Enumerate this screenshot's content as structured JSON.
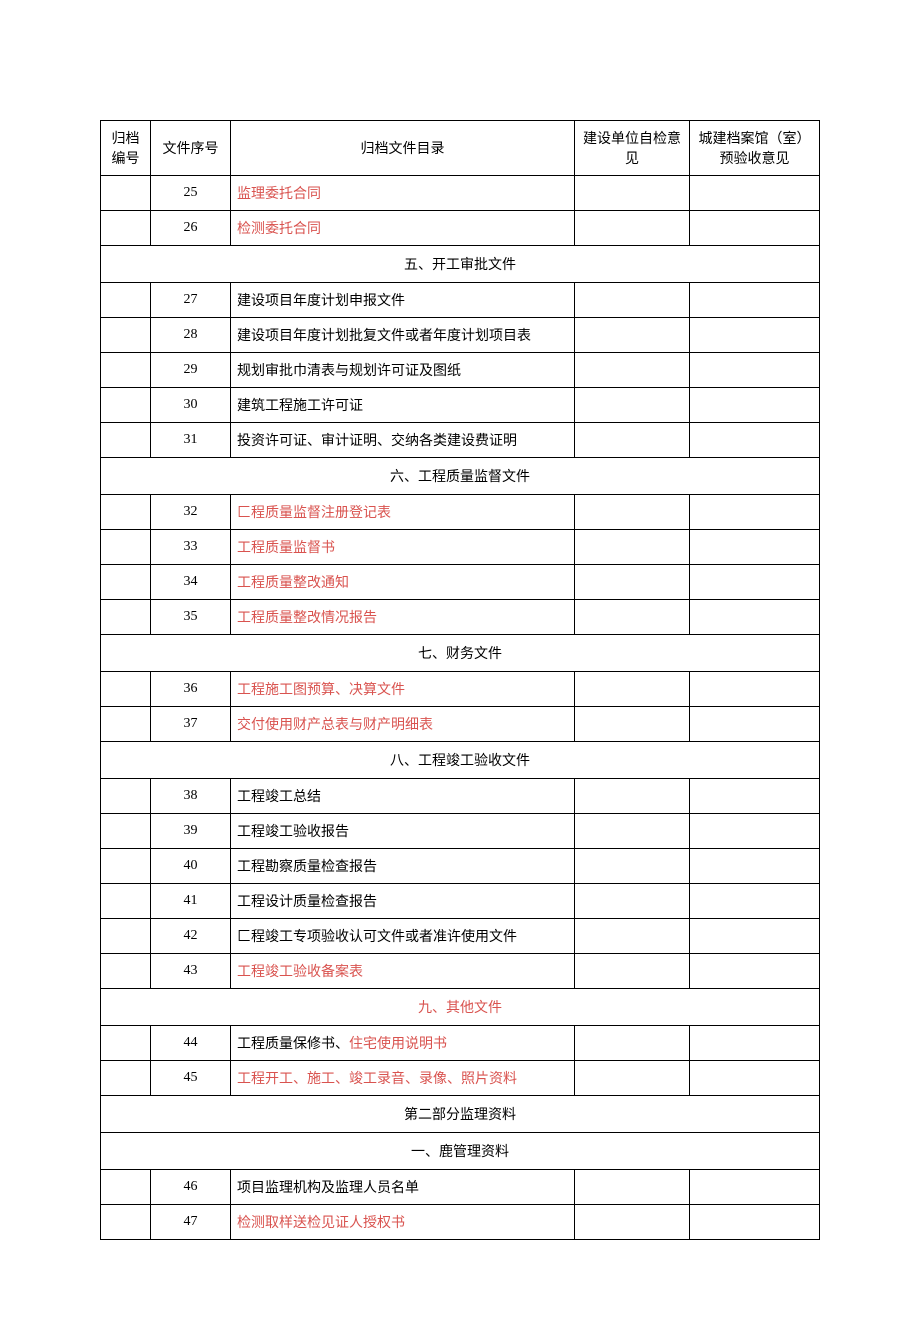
{
  "header": {
    "col_id": "归档编号",
    "col_seq": "文件序号",
    "col_name": "归档文件目录",
    "col_inspect": "建设单位自检意见",
    "col_accept": "城建档案馆（室）预验收意见"
  },
  "rows": [
    {
      "type": "item",
      "seq": "25",
      "name": "监理委托合同",
      "red": true
    },
    {
      "type": "item",
      "seq": "26",
      "name": "检测委托合同",
      "red": true
    },
    {
      "type": "section",
      "title": "五、开工审批文件",
      "red": false
    },
    {
      "type": "item",
      "seq": "27",
      "name": "建设项目年度计划申报文件",
      "red": false
    },
    {
      "type": "item",
      "seq": "28",
      "name": "建设项目年度计划批复文件或者年度计划项目表",
      "red": false
    },
    {
      "type": "item",
      "seq": "29",
      "name": "规划审批巾清表与规划许可证及图纸",
      "red": false
    },
    {
      "type": "item",
      "seq": "30",
      "name": "建筑工程施工许可证",
      "red": false
    },
    {
      "type": "item",
      "seq": "31",
      "name": "投资许可证、审计证明、交纳各类建设费证明",
      "red": false
    },
    {
      "type": "section",
      "title": "六、工程质量监督文件",
      "red": false
    },
    {
      "type": "item",
      "seq": "32",
      "name": "匚程质量监督注册登记表",
      "red": true
    },
    {
      "type": "item",
      "seq": "33",
      "name": "工程质量监督书",
      "red": true
    },
    {
      "type": "item",
      "seq": "34",
      "name": "工程质量整改通知",
      "red": true
    },
    {
      "type": "item",
      "seq": "35",
      "name": "工程质量整改情况报告",
      "red": true
    },
    {
      "type": "section",
      "title": "七、财务文件",
      "red": false
    },
    {
      "type": "item",
      "seq": "36",
      "name": "工程施工图预算、决算文件",
      "red": true
    },
    {
      "type": "item",
      "seq": "37",
      "name": "交付使用财产总表与财产明细表",
      "red": true
    },
    {
      "type": "section",
      "title": "八、工程竣工验收文件",
      "red": false
    },
    {
      "type": "item",
      "seq": "38",
      "name": "工程竣工总结",
      "red": false
    },
    {
      "type": "item",
      "seq": "39",
      "name": "工程竣工验收报告",
      "red": false
    },
    {
      "type": "item",
      "seq": "40",
      "name": "工程勘察质量检查报告",
      "red": false
    },
    {
      "type": "item",
      "seq": "41",
      "name": "工程设计质量检查报告",
      "red": false
    },
    {
      "type": "item",
      "seq": "42",
      "name": "匚程竣工专项验收认可文件或者准许使用文件",
      "red": false
    },
    {
      "type": "item",
      "seq": "43",
      "name": "工程竣工验收备案表",
      "red": true
    },
    {
      "type": "section",
      "title": "九、其他文件",
      "red": true
    },
    {
      "type": "mixed",
      "seq": "44",
      "parts": [
        {
          "text": "工程质量保修书、",
          "red": false
        },
        {
          "text": "住宅使用说明书",
          "red": true
        }
      ]
    },
    {
      "type": "item",
      "seq": "45",
      "name": "工程开工、施工、竣工录音、录像、照片资料",
      "red": true
    },
    {
      "type": "section",
      "title": "第二部分监理资料",
      "red": false
    },
    {
      "type": "section",
      "title": "一、鹿管理资料",
      "red": false
    },
    {
      "type": "item",
      "seq": "46",
      "name": "项目监理机构及监理人员名单",
      "red": false
    },
    {
      "type": "item",
      "seq": "47",
      "name": "检测取样送检见证人授权书",
      "red": true
    }
  ]
}
